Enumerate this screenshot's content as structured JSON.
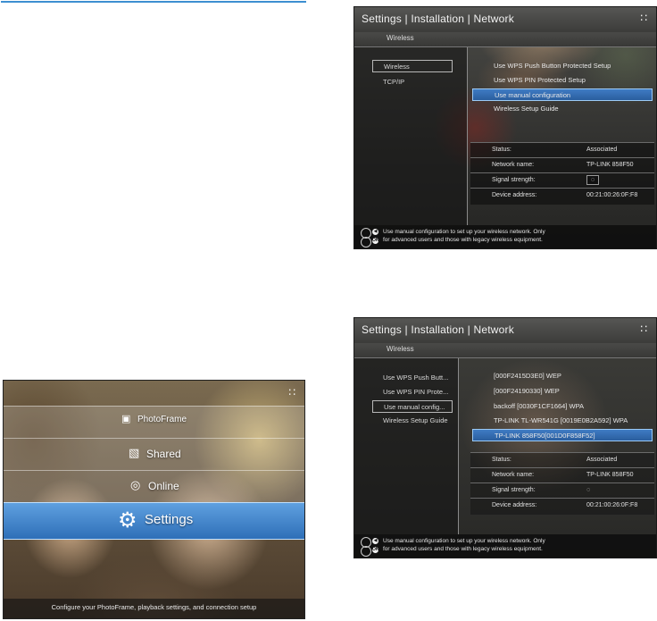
{
  "colors": {
    "accent_line": "#3d8fd1",
    "highlight": "#3f7bc4"
  },
  "screen_top": {
    "title": "Settings | Installation | Network",
    "subtitle": "Wireless",
    "nav": [
      {
        "label": "Wireless"
      },
      {
        "label": "TCP/IP"
      }
    ],
    "options": [
      {
        "label": "Use WPS Push Button Protected Setup"
      },
      {
        "label": "Use WPS PIN Protected Setup"
      },
      {
        "label": "Use manual configuration"
      },
      {
        "label": "Wireless Setup Guide"
      }
    ],
    "status": [
      {
        "key": "Status:",
        "value": "Associated"
      },
      {
        "key": "Network name:",
        "value": "TP-LINK 858F50"
      },
      {
        "key": "Signal strength:",
        "value": "◌"
      },
      {
        "key": "Device address:",
        "value": "00:21:00:26:0F:F8"
      }
    ],
    "footer": {
      "line1": "Use manual configuration to set up your wireless network. Only",
      "line2": "for advanced users and those with legacy wireless equipment.",
      "key_back": "◀",
      "key_ok": "OK"
    },
    "wifi_icon": "wifi-icon"
  },
  "screen_bottom": {
    "title": "Settings | Installation | Network",
    "subtitle": "Wireless",
    "nav": [
      {
        "label": "Use WPS Push Butt..."
      },
      {
        "label": "Use WPS PIN Prote..."
      },
      {
        "label": "Use manual config..."
      },
      {
        "label": "Wireless Setup Guide"
      }
    ],
    "networks": [
      {
        "label": "[000F2415D3E0] WEP"
      },
      {
        "label": "[000F24190330] WEP"
      },
      {
        "label": "backoff [0030F1CF1664] WPA"
      },
      {
        "label": "TP-LINK TL-WR541G [0019E0B2A592] WPA"
      },
      {
        "label": "TP-LINK 858F50[001D0F858F52]"
      }
    ],
    "status": [
      {
        "key": "Status:",
        "value": "Associated"
      },
      {
        "key": "Network name:",
        "value": "TP-LINK 858F50"
      },
      {
        "key": "Signal strength:",
        "value": "◌"
      },
      {
        "key": "Device address:",
        "value": "00:21:00:26:0F:F8"
      }
    ],
    "footer": {
      "line1": "Use manual configuration to set up your wireless network. Only",
      "line2": "for advanced users and those with legacy wireless equipment.",
      "key_back": "◀",
      "key_ok": "OK"
    }
  },
  "home": {
    "items": [
      {
        "label": "PhotoFrame",
        "icon": "photoframe-icon",
        "glyph": "▣"
      },
      {
        "label": "Shared",
        "icon": "shared-icon",
        "glyph": "▧"
      },
      {
        "label": "Online",
        "icon": "globe-icon",
        "glyph": "◎"
      },
      {
        "label": "Settings",
        "icon": "gear-icon",
        "glyph": "⚙"
      }
    ],
    "footer": "Configure your PhotoFrame, playback settings, and connection setup"
  }
}
